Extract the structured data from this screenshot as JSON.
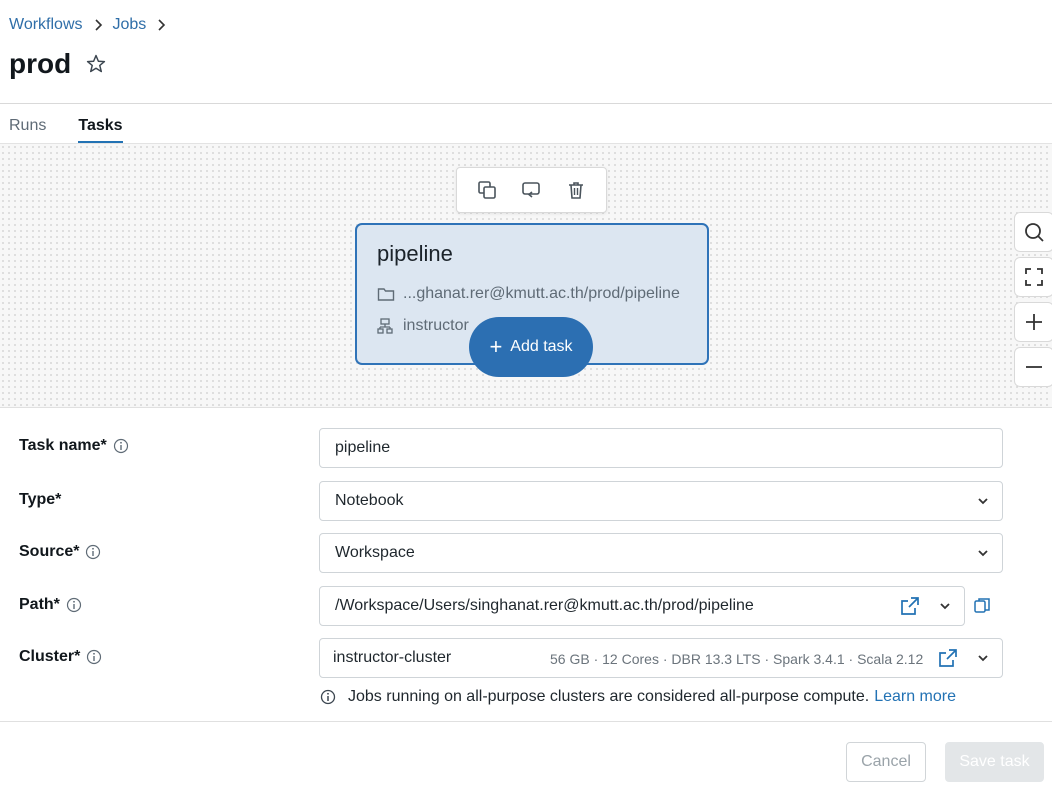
{
  "breadcrumb": {
    "items": [
      "Workflows",
      "Jobs"
    ]
  },
  "page": {
    "title": "prod"
  },
  "tabs": [
    {
      "label": "Runs",
      "active": false
    },
    {
      "label": "Tasks",
      "active": true
    }
  ],
  "canvas": {
    "toolbar": {
      "icons": [
        "duplicate-icon",
        "swap-icon",
        "trash-icon"
      ]
    },
    "task_node": {
      "title": "pipeline",
      "path_text": "...ghanat.rer@kmutt.ac.th/prod/pipeline",
      "cluster_text": "instructor"
    },
    "add_task_label": "Add task",
    "zoom_icons": [
      "search-icon",
      "fit-view-icon",
      "zoom-in-icon",
      "zoom-out-icon"
    ]
  },
  "form": {
    "task_name": {
      "label": "Task name*",
      "value": "pipeline"
    },
    "type": {
      "label": "Type*",
      "value": "Notebook"
    },
    "source": {
      "label": "Source*",
      "value": "Workspace"
    },
    "path": {
      "label": "Path*",
      "value": "/Workspace/Users/singhanat.rer@kmutt.ac.th/prod/pipeline"
    },
    "cluster": {
      "label": "Cluster*",
      "value": "instructor-cluster",
      "meta": "56 GB · 12 Cores · DBR 13.3 LTS · Spark 3.4.1 · Scala 2.12"
    }
  },
  "notice": {
    "text": "Jobs running on all-purpose clusters are considered all-purpose compute.",
    "link": "Learn more"
  },
  "footer": {
    "cancel_label": "Cancel",
    "save_label": "Save task"
  },
  "colors": {
    "accent": "#2272b4",
    "node_bg": "#dce6f1",
    "node_border": "#2f73b8",
    "add_task_bg": "#2c6fb2"
  }
}
